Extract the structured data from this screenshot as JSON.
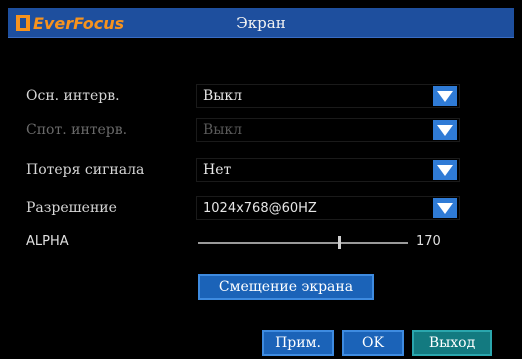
{
  "header": {
    "logo_text": "EverFocus",
    "title": "Экран"
  },
  "settings": [
    {
      "label": "Осн. интерв.",
      "value": "Выкл",
      "enabled": true
    },
    {
      "label": "Спот. интерв.",
      "value": "Выкл",
      "enabled": false
    },
    {
      "label": "Потеря сигнала",
      "value": "Нет",
      "enabled": true
    },
    {
      "label": "Разрешение",
      "value": "1024x768@60HZ",
      "enabled": true
    }
  ],
  "alpha": {
    "label": "ALPHA",
    "value": "170",
    "level_fraction": 0.67
  },
  "buttons": {
    "screen_shift": "Смещение экрана",
    "apply": "Прим.",
    "ok": "OK",
    "exit": "Выход"
  },
  "colors": {
    "titlebar": "#1e4f9e",
    "logo": "#f7931e",
    "dropdown_arrow": "#2f7bd6",
    "button": "#1b63b8",
    "exit_button": "#137a80"
  }
}
